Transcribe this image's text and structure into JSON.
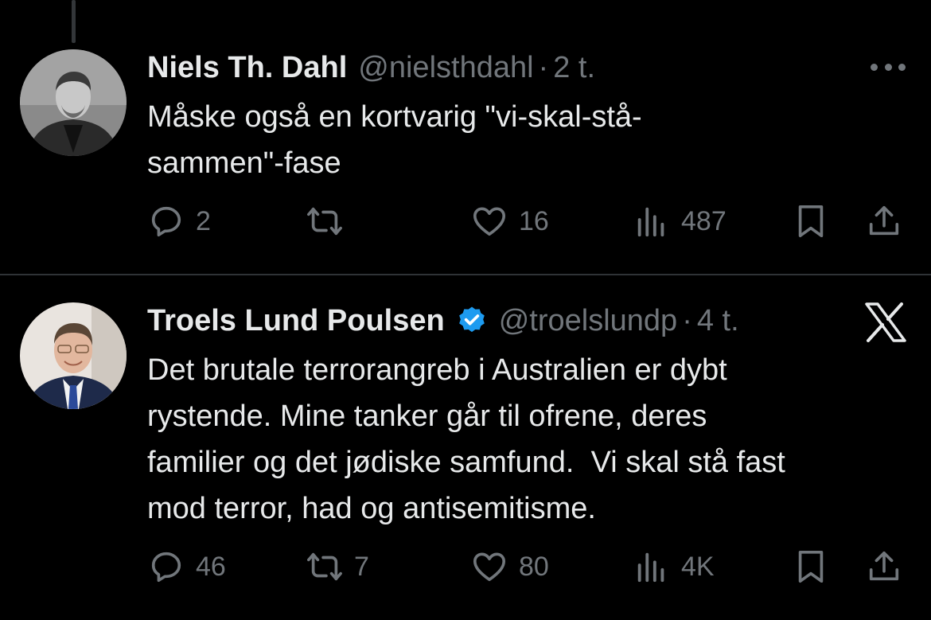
{
  "tweets": [
    {
      "name": "Niels Th. Dahl",
      "handle": "@nielsthdahl",
      "dot": "·",
      "time": "2 t.",
      "text": "Måske også en kortvarig \"vi-skal-stå-\nsammen\"-fase",
      "verified": false,
      "stats": {
        "replies": "2",
        "retweets": "",
        "likes": "16",
        "views": "487"
      }
    },
    {
      "name": "Troels Lund Poulsen",
      "handle": "@troelslundp",
      "dot": "·",
      "time": "4 t.",
      "text": "Det brutale terrorangreb i Australien er dybt\nrystende. Mine tanker går til ofrene, deres\nfamilier og det jødiske samfund.  Vi skal stå fast\nmod terror, had og antisemitisme.",
      "verified": true,
      "stats": {
        "replies": "46",
        "retweets": "7",
        "likes": "80",
        "views": "4K"
      }
    }
  ],
  "colors": {
    "background": "#000000",
    "text": "#e7e9ea",
    "secondary": "#71767b",
    "divider": "#2f3336",
    "verified": "#1d9bf0"
  },
  "icons": [
    "reply-icon",
    "retweet-icon",
    "like-icon",
    "views-icon",
    "bookmark-icon",
    "share-icon",
    "more-icon",
    "x-logo-icon",
    "verified-badge-icon"
  ]
}
